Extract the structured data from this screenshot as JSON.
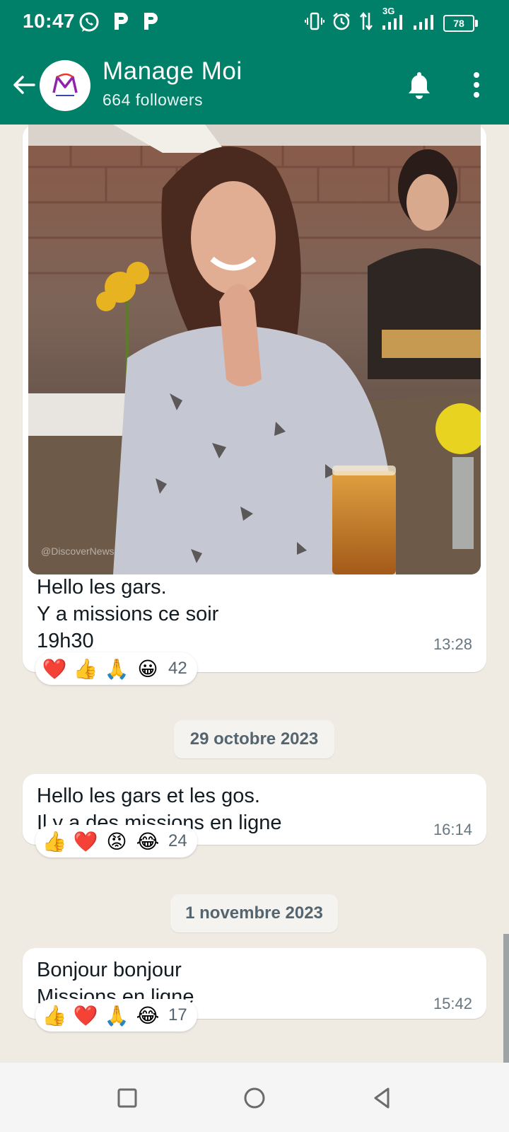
{
  "status_bar": {
    "time": "10:47",
    "left_icons": [
      "whatsapp-icon",
      "p-app-icon",
      "p-app-icon"
    ],
    "right_icons": [
      "vibrate-icon",
      "alarm-icon",
      "data-arrows-icon",
      "signal-3g-icon",
      "signal-icon"
    ],
    "network": "3G",
    "battery": "78"
  },
  "header": {
    "title": "Manage Moi",
    "subtitle": "664 followers",
    "icons": [
      "back-arrow-icon",
      "bell-icon",
      "more-vert-icon"
    ]
  },
  "messages": [
    {
      "has_media": true,
      "text": "Hello les gars.\nY a missions ce soir\n19h30",
      "time": "13:28",
      "reactions": [
        "❤️",
        "👍",
        "🙏",
        "😀"
      ],
      "reaction_count": "42"
    },
    {
      "date": "29 octobre 2023",
      "text": "Hello les gars et les gos.\nIl y a des missions en ligne",
      "time": "16:14",
      "reactions": [
        "👍",
        "❤️",
        "😡",
        "😂"
      ],
      "reaction_count": "24"
    },
    {
      "date": "1 novembre 2023",
      "text": "Bonjour bonjour\nMissions en ligne",
      "time": "15:42",
      "reactions": [
        "👍",
        "❤️",
        "🙏",
        "😂"
      ],
      "reaction_count": "17"
    }
  ],
  "colors": {
    "header": "#008069",
    "chat_background": "#efeae2",
    "bubble": "#ffffff",
    "timestamp": "#667781"
  },
  "nav_bar": {
    "icons": [
      "recents-square-icon",
      "home-circle-icon",
      "back-triangle-icon"
    ]
  }
}
